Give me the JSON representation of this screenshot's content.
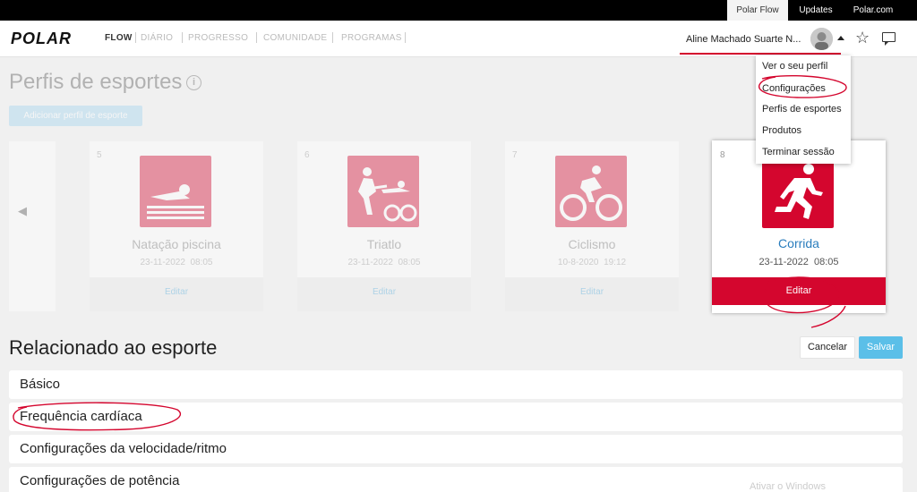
{
  "topbar": {
    "links": [
      {
        "label": "Polar Flow",
        "active": true
      },
      {
        "label": "Updates",
        "active": false
      },
      {
        "label": "Polar.com",
        "active": false
      }
    ]
  },
  "nav": {
    "brand": "POLAR",
    "items": [
      "FLOW",
      "DIÁRIO",
      "PROGRESSO",
      "COMUNIDADE",
      "PROGRAMAS"
    ],
    "user_name": "Aline Machado Suarte N...",
    "icons": [
      "star-icon",
      "chat-icon"
    ]
  },
  "user_menu": {
    "items": [
      "Ver o seu perfil",
      "Configurações",
      "Perfis de esportes",
      "Produtos",
      "Terminar sessão"
    ]
  },
  "page": {
    "title": "Perfis de esportes",
    "info_symbol": "i",
    "add_button": "Adicionar perfil de esporte",
    "prev_arrow": "◀"
  },
  "sport_cards": [
    {
      "number": "5",
      "name": "Natação piscina",
      "date": "23-11-2022",
      "time": "08:05",
      "edit": "Editar",
      "icon": "swimming-icon"
    },
    {
      "number": "6",
      "name": "Triatlo",
      "date": "23-11-2022",
      "time": "08:05",
      "edit": "Editar",
      "icon": "triathlon-icon"
    },
    {
      "number": "7",
      "name": "Ciclismo",
      "date": "10-8-2020",
      "time": "19:12",
      "edit": "Editar",
      "icon": "cycling-icon"
    },
    {
      "number": "8",
      "name": "Corrida",
      "date": "23-11-2022",
      "time": "08:05",
      "edit": "Editar",
      "icon": "running-icon",
      "active": true
    }
  ],
  "related": {
    "title": "Relacionado ao esporte",
    "cancel": "Cancelar",
    "save": "Salvar",
    "sections": [
      "Básico",
      "Frequência cardíaca",
      "Configurações da velocidade/ritmo",
      "Configurações de potência"
    ]
  },
  "watermark": "Ativar o Windows",
  "colors": {
    "brand_red": "#d4062e",
    "link_blue": "#2a7dbd",
    "save_blue": "#5bbfe8",
    "annotation_red": "#d4062e"
  }
}
